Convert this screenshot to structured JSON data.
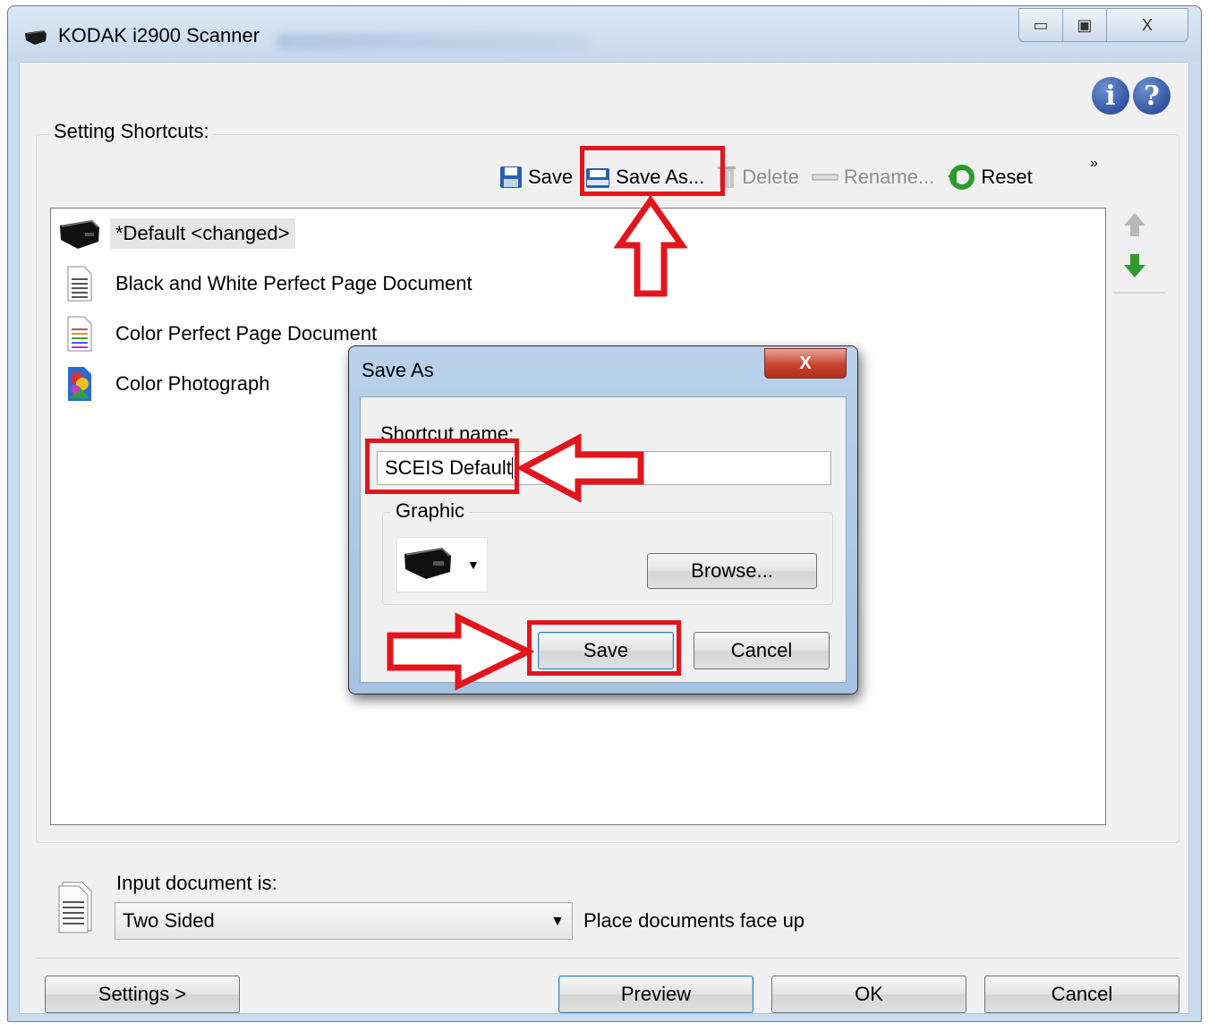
{
  "window": {
    "title": "KODAK i2900 Scanner",
    "minimize_glyph": "▭",
    "maximize_glyph": "▣",
    "close_glyph": "X"
  },
  "shortcuts": {
    "group_label": "Setting Shortcuts:",
    "toolbar": {
      "save": "Save",
      "save_as": "Save As...",
      "delete": "Delete",
      "rename": "Rename...",
      "reset": "Reset",
      "more": "»"
    },
    "items": [
      {
        "label": "*Default <changed>",
        "icon": "scanner-icon"
      },
      {
        "label": "Black and White Perfect Page Document",
        "icon": "bw-document-icon"
      },
      {
        "label": "Color Perfect Page Document",
        "icon": "color-document-icon"
      },
      {
        "label": "Color Photograph",
        "icon": "color-photo-icon"
      }
    ]
  },
  "input": {
    "label": "Input document is:",
    "value": "Two Sided",
    "hint": "Place documents face up"
  },
  "buttons": {
    "settings": "Settings >",
    "preview": "Preview",
    "ok": "OK",
    "cancel": "Cancel"
  },
  "dialog": {
    "title": "Save As",
    "close_glyph": "X",
    "shortcut_label": "Shortcut name:",
    "shortcut_value": "SCEIS Default",
    "graphic_label": "Graphic",
    "browse": "Browse...",
    "save": "Save",
    "cancel": "Cancel"
  },
  "colors": {
    "annotation_red": "#e3141c",
    "title_bar": "#c9dbee",
    "help_blue": "#1d3d8f",
    "arrow_green": "#2e9a2e"
  }
}
